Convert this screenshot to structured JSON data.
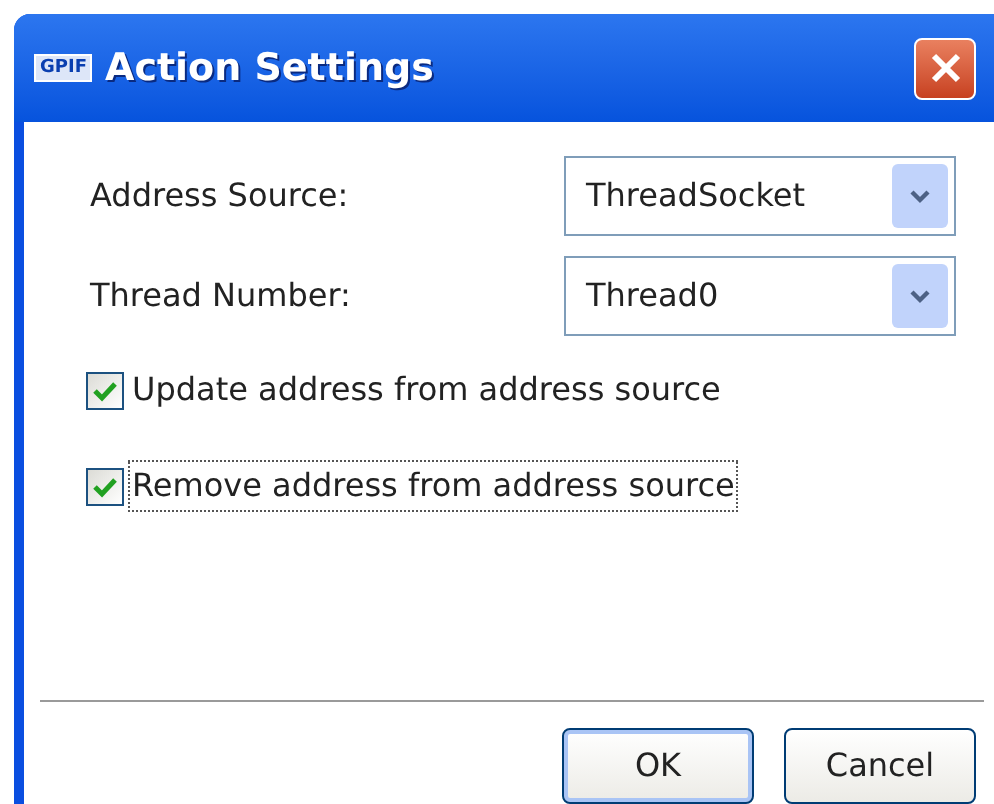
{
  "window": {
    "title": "Action Settings",
    "app_badge": "GPIF"
  },
  "fields": [
    {
      "label": "Address Source:",
      "value": "ThreadSocket"
    },
    {
      "label": "Thread Number:",
      "value": "Thread0"
    }
  ],
  "checkboxes": [
    {
      "label": "Update address from address source",
      "checked": true,
      "focused": false
    },
    {
      "label": "Remove address from address source",
      "checked": true,
      "focused": true
    }
  ],
  "buttons": [
    {
      "label": "OK",
      "default": true
    },
    {
      "label": "Cancel",
      "default": false
    }
  ]
}
